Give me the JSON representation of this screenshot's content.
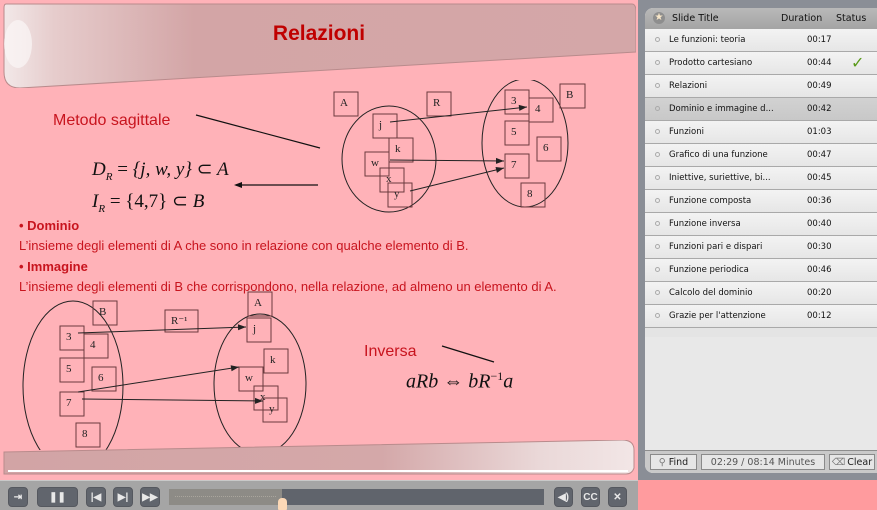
{
  "slide": {
    "title": "Relazioni",
    "method_label": "Metodo sagittale",
    "domain_formula": {
      "lhs": "D",
      "sub": "R",
      "set": "{j, w, y}",
      "rel": "⊂",
      "rhs": "A"
    },
    "image_formula": {
      "lhs": "I",
      "sub": "R",
      "set": "{4,7}",
      "rel": "⊂",
      "rhs": "B"
    },
    "bullets": [
      {
        "head": "• Dominio",
        "text": "L’insieme degli elementi di A che sono in relazione con qualche elemento di B."
      },
      {
        "head": "• Immagine",
        "text": "L’insieme degli elementi di B che corrispondono, nella relazione, ad almeno un elemento di A."
      }
    ],
    "inverse_label": "Inversa",
    "inverse_formula": {
      "left": "aRb",
      "arrow": "⇔",
      "right_a": "bR",
      "exp": "−1",
      "right_b": "a"
    },
    "diagram_relation": {
      "set_a_label": "A",
      "relation_label": "R",
      "set_b_label": "B",
      "set_a": [
        "j",
        "k",
        "w",
        "x",
        "y"
      ],
      "set_b": [
        "3",
        "4",
        "5",
        "6",
        "7",
        "8"
      ],
      "arrows": [
        [
          "j",
          "4"
        ],
        [
          "w",
          "7"
        ],
        [
          "y",
          "7"
        ]
      ]
    },
    "diagram_inverse": {
      "set_b_label": "B",
      "relation_label": "R⁻¹",
      "set_a_label": "A",
      "set_b": [
        "3",
        "4",
        "5",
        "6",
        "7",
        "8"
      ],
      "set_a": [
        "j",
        "k",
        "w",
        "x",
        "y"
      ],
      "arrows": [
        [
          "3",
          "j"
        ],
        [
          "7",
          "w"
        ],
        [
          "7",
          "y"
        ]
      ]
    }
  },
  "controls": {
    "exit_icon": "exit-icon",
    "pause_icon": "pause-icon",
    "prev_icon": "skip-back-icon",
    "next_icon": "skip-forward-icon",
    "ffwd_icon": "fast-forward-icon",
    "progress_fraction": 0.3,
    "volume_icon": "speaker-icon",
    "cc_label": "CC",
    "close_label": "✕"
  },
  "panel": {
    "header": {
      "title": "Slide Title",
      "duration": "Duration",
      "status": "Status"
    },
    "slides": [
      {
        "title": "Le funzioni: teoria",
        "duration": "00:17",
        "status": ""
      },
      {
        "title": "Prodotto cartesiano",
        "duration": "00:44",
        "status": "✓"
      },
      {
        "title": "Relazioni",
        "duration": "00:49",
        "status": ""
      },
      {
        "title": "Dominio e immagine d...",
        "duration": "00:42",
        "status": "",
        "selected": true
      },
      {
        "title": "Funzioni",
        "duration": "01:03",
        "status": ""
      },
      {
        "title": "Grafico di una funzione",
        "duration": "00:47",
        "status": ""
      },
      {
        "title": "Iniettive, suriettive, bi...",
        "duration": "00:45",
        "status": ""
      },
      {
        "title": "Funzione composta",
        "duration": "00:36",
        "status": ""
      },
      {
        "title": "Funzione inversa",
        "duration": "00:40",
        "status": ""
      },
      {
        "title": "Funzioni pari e dispari",
        "duration": "00:30",
        "status": ""
      },
      {
        "title": "Funzione periodica",
        "duration": "00:46",
        "status": ""
      },
      {
        "title": "Calcolo del dominio",
        "duration": "00:20",
        "status": ""
      },
      {
        "title": "Grazie per l'attenzione",
        "duration": "00:12",
        "status": ""
      }
    ],
    "footer": {
      "find_label": "Find",
      "time_readout": "02:29 / 08:14 Minutes",
      "clear_label": "Clear"
    }
  }
}
